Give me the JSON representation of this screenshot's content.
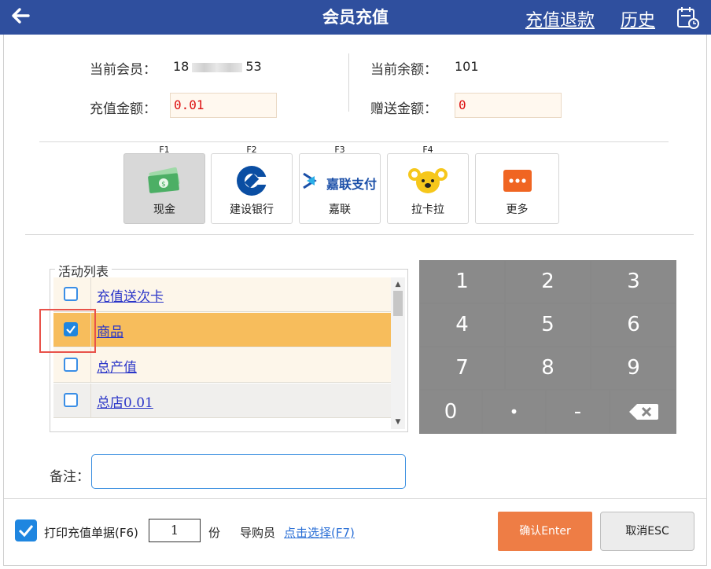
{
  "header": {
    "title": "会员充值",
    "refund_link": "充值退款",
    "history_link": "历史"
  },
  "member": {
    "current_member_label": "当前会员：",
    "member_phone_start": "18",
    "member_phone_end": "53",
    "balance_label": "当前余额：",
    "balance_value": "101",
    "recharge_label": "充值金额：",
    "recharge_value": "0.01",
    "bonus_label": "赠送金额：",
    "bonus_value": "0"
  },
  "payment": {
    "methods": [
      {
        "key": "F1",
        "label": "现金",
        "icon": "cash-icon",
        "selected": true
      },
      {
        "key": "F2",
        "label": "建设银行",
        "icon": "ccb-logo-icon",
        "selected": false
      },
      {
        "key": "F3",
        "label": "嘉联",
        "icon": "jialian-pay-logo-icon",
        "logo_text": "嘉联支付",
        "selected": false
      },
      {
        "key": "F4",
        "label": "拉卡拉",
        "icon": "lakala-logo-icon",
        "selected": false
      },
      {
        "key": "",
        "label": "更多",
        "icon": "more-icon",
        "selected": false
      }
    ]
  },
  "activities": {
    "title": "活动列表",
    "items": [
      {
        "name": "充值送次卡",
        "checked": false
      },
      {
        "name": "商品",
        "checked": true
      },
      {
        "name": "总产值",
        "checked": false
      },
      {
        "name": "总店0.01",
        "checked": false
      }
    ]
  },
  "keypad": {
    "digits": [
      "1",
      "2",
      "3",
      "4",
      "5",
      "6",
      "7",
      "8",
      "9"
    ],
    "zero": "0",
    "dot": "•",
    "minus": "-",
    "backspace_icon": "backspace-icon"
  },
  "remarks": {
    "label": "备注：",
    "value": ""
  },
  "footer": {
    "print_label": "打印充值单据(F6)",
    "print_checked": true,
    "copies_value": "1",
    "copies_unit": "份",
    "guide_label": "导购员",
    "guide_select_link": "点击选择(F7)",
    "confirm_label": "确认Enter",
    "cancel_label": "取消ESC"
  },
  "colors": {
    "header_bg": "#2f4f9e",
    "selected_row": "#f7bd5c",
    "keypad": "#888888",
    "confirm": "#ee7d45",
    "link": "#2a35c8"
  }
}
